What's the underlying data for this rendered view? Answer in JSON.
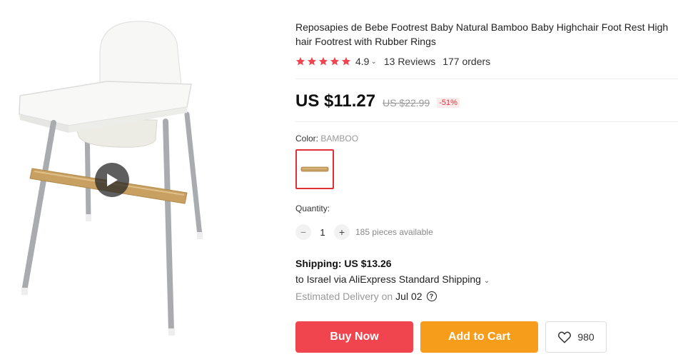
{
  "product": {
    "title_line1": "Reposapies de Bebe Footrest Baby Natural Bamboo Baby Highchair Foot Rest High",
    "title_line2": "hair Footrest with Rubber Rings",
    "rating": "4.9",
    "stars": 5,
    "reviews": "13 Reviews",
    "orders": "177 orders"
  },
  "price": {
    "current": "US $11.27",
    "original": "US $22.99",
    "discount": "-51%"
  },
  "color": {
    "label": "Color:",
    "value": "BAMBOO"
  },
  "quantity": {
    "label": "Quantity:",
    "value": "1",
    "minus": "−",
    "plus": "+",
    "available": "185 pieces available"
  },
  "shipping": {
    "heading": "Shipping: US $13.26",
    "destination": "to Israel via AliExpress Standard Shipping",
    "estimated_label": "Estimated Delivery on",
    "date": "Jul 02",
    "help": "?"
  },
  "actions": {
    "buy_now": "Buy Now",
    "add_to_cart": "Add to Cart",
    "wishlist_count": "980"
  },
  "colors": {
    "star": "#f0454f",
    "buy": "#f0454f",
    "cart": "#f79d1c",
    "discount": "#e0313b"
  },
  "icons": {
    "play": "play-icon",
    "star": "star-icon",
    "heart": "heart-icon",
    "help": "question-icon"
  }
}
